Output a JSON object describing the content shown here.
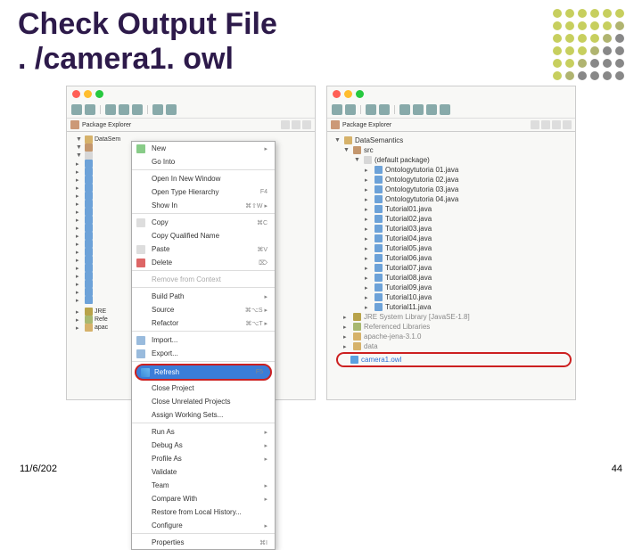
{
  "slide": {
    "title": "Check Output File\n. /camera1. owl",
    "date": "11/6/202",
    "page": "44"
  },
  "leftIDE": {
    "tabLabel": "Package Explorer",
    "project": "DataSem",
    "contextMenu": [
      {
        "label": "New",
        "icon": "ci-new",
        "sub": "▸",
        "sep": false
      },
      {
        "label": "Go Into",
        "sep": true
      },
      {
        "label": "Open In New Window"
      },
      {
        "label": "Open Type Hierarchy",
        "short": "F4"
      },
      {
        "label": "Show In",
        "short": "⌘⇧W ▸",
        "sep": true
      },
      {
        "label": "Copy",
        "icon": "ci-copy",
        "short": "⌘C"
      },
      {
        "label": "Copy Qualified Name"
      },
      {
        "label": "Paste",
        "icon": "ci-paste",
        "short": "⌘V"
      },
      {
        "label": "Delete",
        "icon": "ci-del",
        "short": "⌦",
        "sep": true
      },
      {
        "label": "Remove from Context",
        "disabled": true,
        "sep": true
      },
      {
        "label": "Build Path",
        "sub": "▸"
      },
      {
        "label": "Source",
        "short": "⌘⌥S ▸"
      },
      {
        "label": "Refactor",
        "short": "⌘⌥T ▸",
        "sep": true
      },
      {
        "label": "Import...",
        "icon": "ci-imp"
      },
      {
        "label": "Export...",
        "icon": "ci-exp",
        "sep": true
      },
      {
        "label": "Refresh",
        "icon": "ci-ref",
        "short": "F5",
        "highlight": true
      },
      {
        "label": "Close Project"
      },
      {
        "label": "Close Unrelated Projects"
      },
      {
        "label": "Assign Working Sets...",
        "sep": true
      },
      {
        "label": "Run As",
        "sub": "▸"
      },
      {
        "label": "Debug As",
        "sub": "▸"
      },
      {
        "label": "Profile As",
        "sub": "▸"
      },
      {
        "label": "Validate"
      },
      {
        "label": "Team",
        "sub": "▸"
      },
      {
        "label": "Compare With",
        "sub": "▸"
      },
      {
        "label": "Restore from Local History..."
      },
      {
        "label": "Configure",
        "sub": "▸",
        "sep": true
      },
      {
        "label": "Properties",
        "short": "⌘I"
      }
    ],
    "leftMini": [
      "JRE",
      "Refe",
      "apac"
    ]
  },
  "rightIDE": {
    "tabLabel": "Package Explorer",
    "project": "DataSemantics",
    "srcLabel": "src",
    "pkgLabel": "(default package)",
    "files": [
      "Ontologytutoria 01.java",
      "Ontologytutoria 02.java",
      "Ontologytutoria 03.java",
      "Ontologytutoria 04.java",
      "Tutorial01.java",
      "Tutorial02.java",
      "Tutorial03.java",
      "Tutorial04.java",
      "Tutorial05.java",
      "Tutorial06.java",
      "Tutorial07.java",
      "Tutorial08.java",
      "Tutorial09.java",
      "Tutorial10.java",
      "Tutorial11.java"
    ],
    "libs": [
      {
        "label": "JRE System Library [JavaSE-1.8]",
        "icon": "i-jre"
      },
      {
        "label": "Referenced Libraries",
        "icon": "i-lib"
      },
      {
        "label": "apache-jena-3.1.0",
        "icon": "i-fold"
      },
      {
        "label": "data",
        "icon": "i-fold"
      }
    ],
    "owlFile": "camera1.owl"
  }
}
